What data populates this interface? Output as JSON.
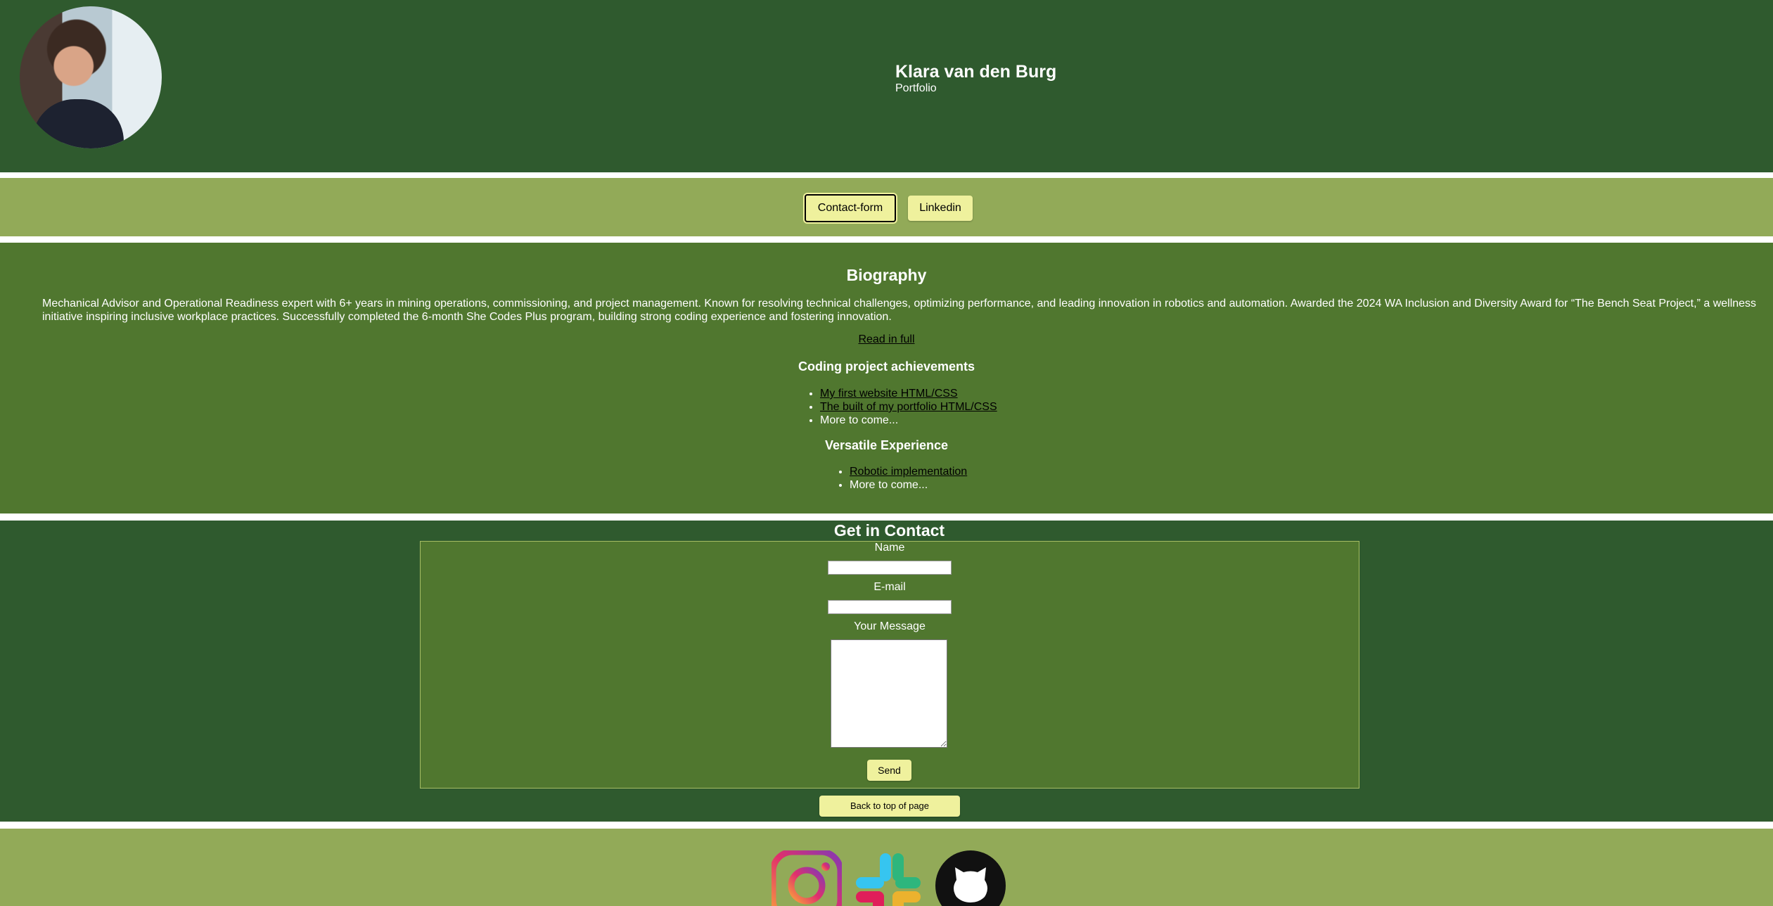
{
  "header": {
    "name": "Klara van den Burg",
    "subtitle": "Portfolio"
  },
  "nav": {
    "contact_label": "Contact-form",
    "linkedin_label": "Linkedin"
  },
  "biography": {
    "heading": "Biography",
    "text": "Mechanical Advisor and Operational Readiness expert with 6+ years in mining operations, commissioning, and project management. Known for resolving technical challenges, optimizing performance, and leading innovation in robotics and automation. Awarded the 2024 WA Inclusion and Diversity Award for “The Bench Seat Project,” a wellness initiative inspiring inclusive workplace practices. Successfully completed the 6-month She Codes Plus program, building strong coding experience and fostering innovation.",
    "read_more": "Read in full",
    "coding_heading": "Coding project achievements",
    "coding_items": [
      "My first website HTML/CSS",
      "The built of my portfolio HTML/CSS",
      "More to come..."
    ],
    "experience_heading": "Versatile Experience",
    "experience_items": [
      "Robotic implementation",
      "More to come..."
    ]
  },
  "contact": {
    "heading": "Get in Contact",
    "name_label": "Name",
    "email_label": "E-mail",
    "message_label": "Your Message",
    "send_label": "Send",
    "back_to_top": "Back to top of page"
  },
  "footer": {
    "icons": [
      "instagram-icon",
      "slack-icon",
      "github-icon"
    ]
  },
  "colors": {
    "dark_green": "#2f5a2e",
    "mid_green": "#50772f",
    "light_green": "#92aa58",
    "button_yellow": "#eff19d"
  }
}
